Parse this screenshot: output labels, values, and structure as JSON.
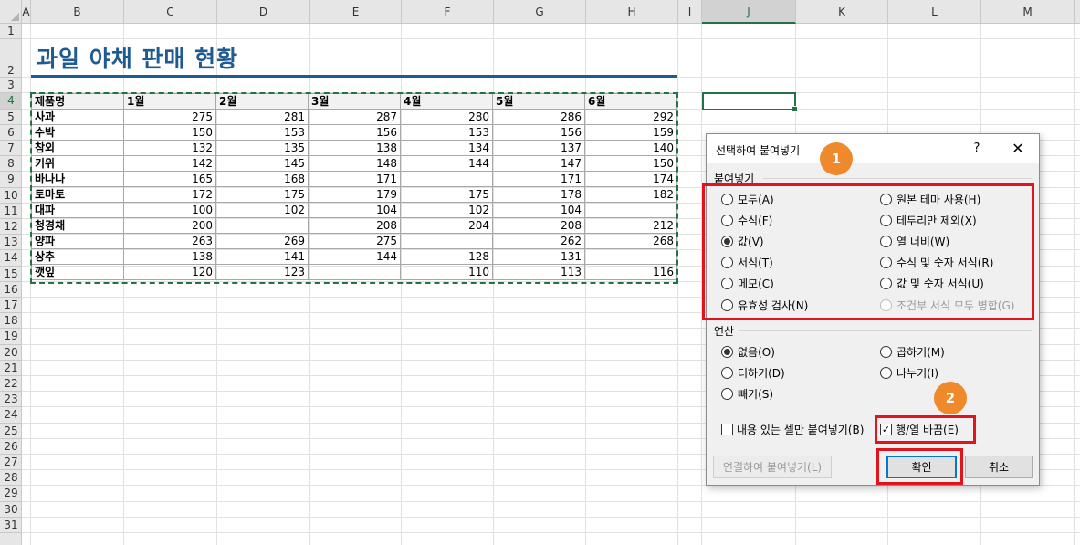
{
  "columns": [
    "A",
    "B",
    "C",
    "D",
    "E",
    "F",
    "G",
    "H",
    "I",
    "J",
    "K",
    "L",
    "M"
  ],
  "active_column": "J",
  "rows": [
    "1",
    "2",
    "3",
    "4",
    "5",
    "6",
    "7",
    "8",
    "9",
    "10",
    "11",
    "12",
    "13",
    "14",
    "15",
    "16",
    "17",
    "18",
    "19",
    "20",
    "21",
    "22",
    "23",
    "24",
    "25",
    "26",
    "27",
    "28",
    "29",
    "30",
    "31"
  ],
  "active_row": "4",
  "sheet": {
    "title": "과일 야채 판매 현황",
    "table": {
      "headers": [
        "제품명",
        "1월",
        "2월",
        "3월",
        "4월",
        "5월",
        "6월"
      ],
      "rows": [
        [
          "사과",
          "275",
          "281",
          "287",
          "280",
          "286",
          "292"
        ],
        [
          "수박",
          "150",
          "153",
          "156",
          "153",
          "156",
          "159"
        ],
        [
          "참외",
          "132",
          "135",
          "138",
          "134",
          "137",
          "140"
        ],
        [
          "키위",
          "142",
          "145",
          "148",
          "144",
          "147",
          "150"
        ],
        [
          "바나나",
          "165",
          "168",
          "171",
          "",
          "171",
          "174"
        ],
        [
          "토마토",
          "172",
          "175",
          "179",
          "175",
          "178",
          "182"
        ],
        [
          "대파",
          "100",
          "102",
          "104",
          "102",
          "104",
          ""
        ],
        [
          "청경채",
          "200",
          "",
          "208",
          "204",
          "208",
          "212"
        ],
        [
          "양파",
          "263",
          "269",
          "275",
          "",
          "262",
          "268"
        ],
        [
          "상추",
          "138",
          "141",
          "144",
          "128",
          "131",
          ""
        ],
        [
          "깻잎",
          "120",
          "123",
          "",
          "110",
          "113",
          "116"
        ]
      ]
    }
  },
  "dialog": {
    "title": "선택하여 붙여넣기",
    "help": "?",
    "close": "✕",
    "paste_group_label": "붙여넣기",
    "paste_options": [
      {
        "label": "모두(A)",
        "checked": false,
        "disabled": false
      },
      {
        "label": "수식(F)",
        "checked": false,
        "disabled": false
      },
      {
        "label": "값(V)",
        "checked": true,
        "disabled": false
      },
      {
        "label": "서식(T)",
        "checked": false,
        "disabled": false
      },
      {
        "label": "메모(C)",
        "checked": false,
        "disabled": false
      },
      {
        "label": "유효성 검사(N)",
        "checked": false,
        "disabled": false
      },
      {
        "label": "원본 테마 사용(H)",
        "checked": false,
        "disabled": false
      },
      {
        "label": "테두리만 제외(X)",
        "checked": false,
        "disabled": false
      },
      {
        "label": "열 너비(W)",
        "checked": false,
        "disabled": false
      },
      {
        "label": "수식 및 숫자 서식(R)",
        "checked": false,
        "disabled": false
      },
      {
        "label": "값 및 숫자 서식(U)",
        "checked": false,
        "disabled": false
      },
      {
        "label": "조건부 서식 모두 병합(G)",
        "checked": false,
        "disabled": true
      }
    ],
    "operation_group_label": "연산",
    "operation_options": [
      {
        "label": "없음(O)",
        "checked": true
      },
      {
        "label": "더하기(D)",
        "checked": false
      },
      {
        "label": "빼기(S)",
        "checked": false
      },
      {
        "label": "곱하기(M)",
        "checked": false
      },
      {
        "label": "나누기(I)",
        "checked": false
      }
    ],
    "skip_blanks_label": "내용 있는 셀만 붙여넣기(B)",
    "skip_blanks_checked": false,
    "transpose_label": "행/열 바꿈(E)",
    "transpose_checked": true,
    "paste_link_label": "연결하여 붙여넣기(L)",
    "ok_label": "확인",
    "cancel_label": "취소"
  },
  "annotations": {
    "badge_1": "1",
    "badge_2": "2",
    "badge_color": "#f0882c",
    "box_color": "#e0141c"
  },
  "colors": {
    "title_blue": "#1f5a93",
    "excel_green": "#217346"
  }
}
